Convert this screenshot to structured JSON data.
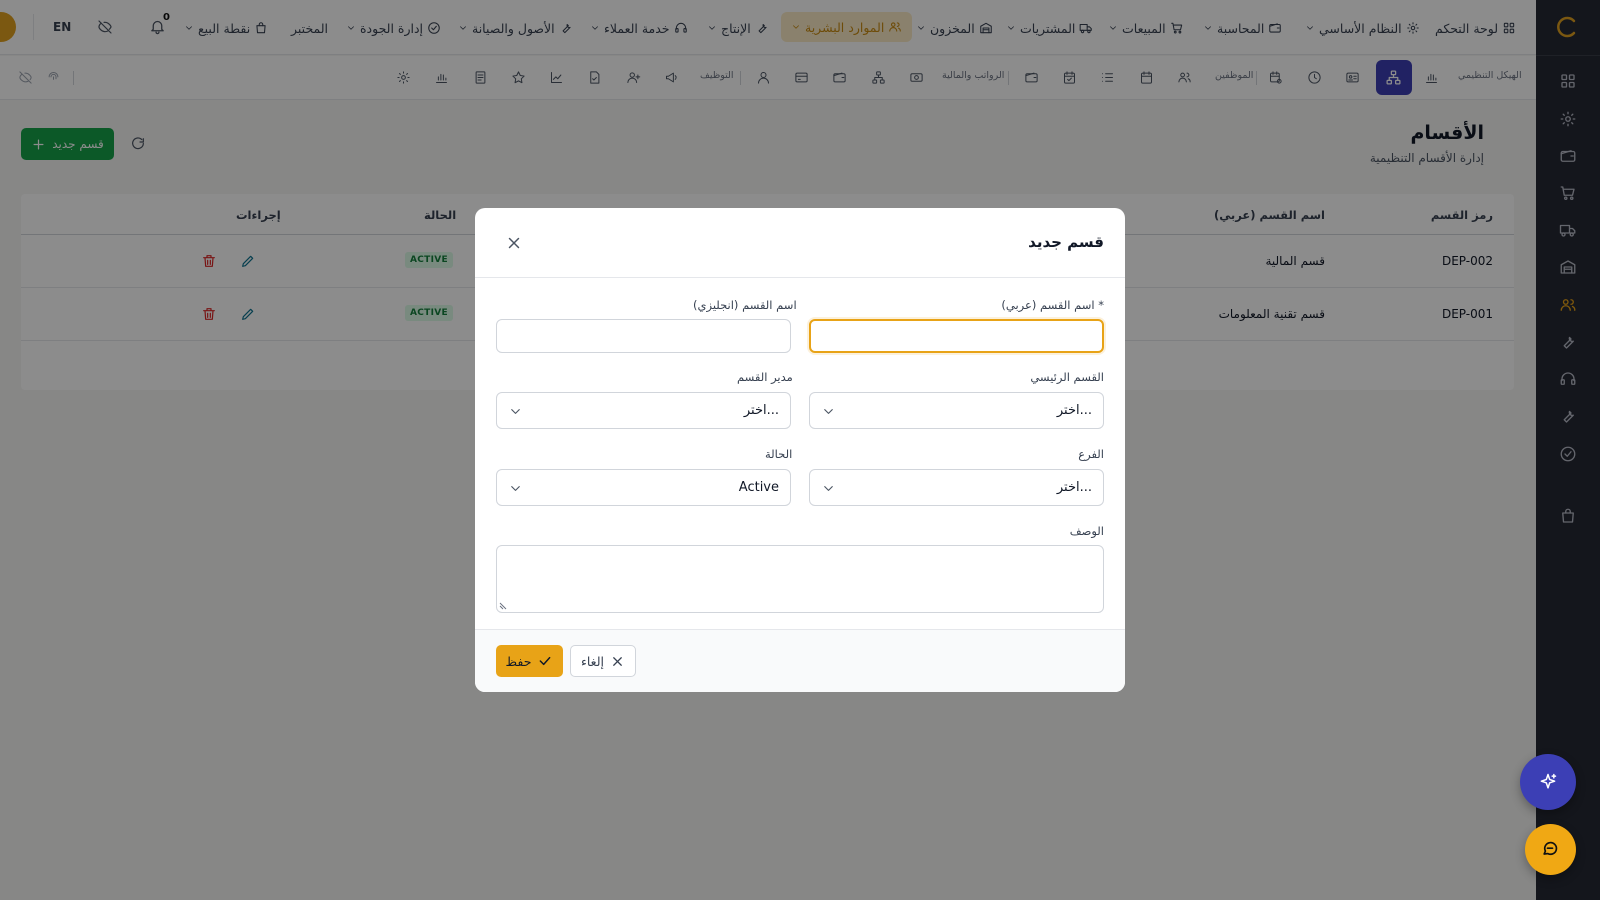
{
  "colors": {
    "accent": "#e8a317",
    "primary": "#3c3fb5",
    "success": "#16a34a",
    "danger": "#dc2626",
    "rail": "#262833"
  },
  "topnav": {
    "items": [
      {
        "label": "لوحة التحكم",
        "icon": "grid-icon"
      },
      {
        "label": "النظام الأساسي",
        "icon": "gear-icon"
      },
      {
        "label": "المحاسبة",
        "icon": "wallet-icon"
      },
      {
        "label": "المبيعات",
        "icon": "cart-icon"
      },
      {
        "label": "المشتريات",
        "icon": "truck-icon"
      },
      {
        "label": "المخزون",
        "icon": "warehouse-icon"
      },
      {
        "label": "الموارد البشرية",
        "icon": "users-icon"
      },
      {
        "label": "الإنتاج",
        "icon": "wrench-icon"
      },
      {
        "label": "خدمة العملاء",
        "icon": "headset-icon"
      },
      {
        "label": "الأصول والصيانة",
        "icon": "tools-icon"
      },
      {
        "label": "إدارة الجودة",
        "icon": "check-circle-icon"
      },
      {
        "label": "المختبر",
        "icon": "flask-icon"
      },
      {
        "label": "نقطة البيع",
        "icon": "bag-icon"
      }
    ],
    "notification_count": "0",
    "lang": "EN"
  },
  "subnav": {
    "labels": [
      "الهيكل التنظيمي",
      "الموظفين",
      "الرواتب والمالية",
      "التوظيف"
    ]
  },
  "page": {
    "title": "الأقسام",
    "subtitle": "إدارة الأقسام التنظيمية",
    "new_button": "قسم جديد"
  },
  "table": {
    "headers": {
      "code": "رمز القسم",
      "name_ar": "اسم القسم (عربي)",
      "status": "الحالة",
      "actions": "إجراءات"
    },
    "rows": [
      {
        "code": "DEP-002",
        "name_ar": "قسم المالية",
        "status": "ACTIVE"
      },
      {
        "code": "DEP-001",
        "name_ar": "قسم تقنية المعلومات",
        "status": "ACTIVE"
      }
    ]
  },
  "modal": {
    "title": "قسم جديد",
    "fields": {
      "name_ar": {
        "label": "اسم القسم (عربي) *",
        "value": ""
      },
      "name_en": {
        "label": "اسم القسم (انجليزي)",
        "value": ""
      },
      "parent": {
        "label": "القسم الرئيسي",
        "value": "اختر..."
      },
      "manager": {
        "label": "مدير القسم",
        "value": "اختر..."
      },
      "branch": {
        "label": "الفرع",
        "value": "اختر..."
      },
      "status": {
        "label": "الحالة",
        "value": "Active"
      },
      "description": {
        "label": "الوصف",
        "value": ""
      }
    },
    "save_label": "حفظ",
    "cancel_label": "إلغاء"
  }
}
